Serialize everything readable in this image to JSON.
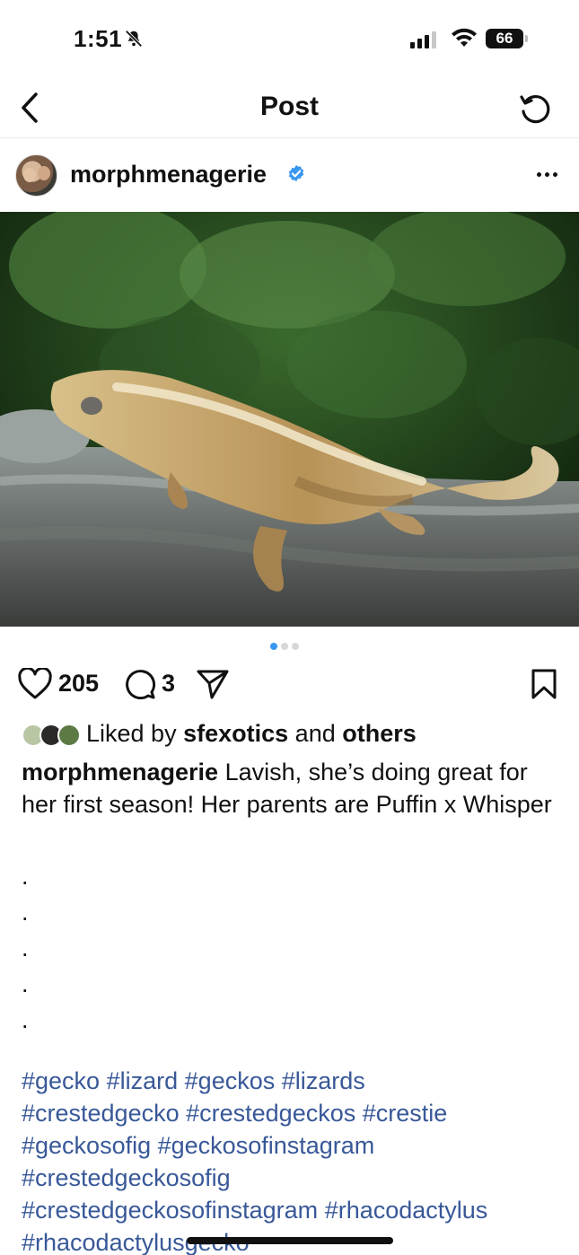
{
  "status_bar": {
    "time": "1:51",
    "battery": "66"
  },
  "header": {
    "title": "Post"
  },
  "post": {
    "username": "morphmenagerie",
    "likes": "205",
    "comments": "3",
    "liked_by_prefix": "Liked by",
    "liked_by_user": "sfexotics",
    "liked_by_and": "and",
    "liked_by_others": "others",
    "caption_user": "morphmenagerie",
    "caption_text": " Lavish, she’s doing great for her first season! Her parents are Puffin x Whisper",
    "dots": [
      ".",
      ".",
      ".",
      ".",
      "."
    ],
    "hashtags": [
      "#gecko",
      "#lizard",
      "#geckos",
      "#lizards",
      "#crestedgecko",
      "#crestedgeckos",
      "#crestie",
      "#geckosofig",
      "#geckosofinstagram",
      "#crestedgeckosofig",
      "#crestedgeckosofinstagram",
      "#rhacodactylus",
      "#rhacodactylusgecko"
    ]
  },
  "colors": {
    "accent": "#3897f0",
    "hashtag": "#385898",
    "verified": "#3897f0"
  },
  "icons": [
    "bell-slash-icon",
    "signal-icon",
    "wifi-icon",
    "battery-icon",
    "back-icon",
    "refresh-icon",
    "verified-icon",
    "more-icon",
    "heart-icon",
    "comment-icon",
    "share-icon",
    "bookmark-icon"
  ]
}
